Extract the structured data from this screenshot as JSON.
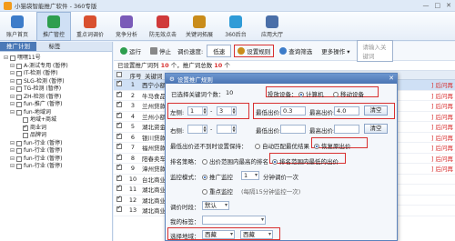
{
  "window": {
    "title": "小猫袋智能推广软件 - 360专版",
    "controls": [
      "—",
      "□",
      "✕"
    ]
  },
  "toolbar": [
    {
      "label": "账户首页",
      "icon": "home-icon",
      "color": "#3d7cc9"
    },
    {
      "label": "推广管控",
      "icon": "chart-icon",
      "color": "#2e9e4e",
      "active": true
    },
    {
      "label": "重点词调价",
      "icon": "target-icon",
      "color": "#d9502f"
    },
    {
      "label": "竞争分析",
      "icon": "eye-icon",
      "color": "#7a5bb8"
    },
    {
      "label": "防无效点击",
      "icon": "shield-icon",
      "color": "#d03a3a"
    },
    {
      "label": "关键词拓展",
      "icon": "key-icon",
      "color": "#c98c1a"
    },
    {
      "label": "360后台",
      "icon": "circle-icon",
      "color": "#2f9bd7"
    },
    {
      "label": "应用大厅",
      "icon": "grid-icon",
      "color": "#4a6fa8"
    }
  ],
  "left_tabs": [
    "推广计划",
    "标签"
  ],
  "tree": [
    {
      "label": "嘿嘿11号",
      "indent": 0,
      "checked": false
    },
    {
      "label": "A-测试专用 (暂停)",
      "indent": 1,
      "checked": false
    },
    {
      "label": "IT-检测 (暂停)",
      "indent": 1,
      "checked": false
    },
    {
      "label": "SLG-检测 (暂停)",
      "indent": 1,
      "checked": false
    },
    {
      "label": "TG-检测 (暂停)",
      "indent": 1,
      "checked": false
    },
    {
      "label": "ZH-检测 (暂停)",
      "indent": 1,
      "checked": false
    },
    {
      "label": "fun-推广 (暂停)",
      "indent": 1,
      "checked": false
    },
    {
      "label": "fun-地域词",
      "indent": 1,
      "checked": false
    },
    {
      "label": "地域+商城",
      "indent": 2,
      "checked": false
    },
    {
      "label": "商业词",
      "indent": 2,
      "checked": true
    },
    {
      "label": "品牌词",
      "indent": 2,
      "checked": false
    },
    {
      "label": "fun-行业 (暂停)",
      "indent": 1,
      "checked": false
    },
    {
      "label": "fun-行业 (暂停)",
      "indent": 1,
      "checked": false
    },
    {
      "label": "fun-行业 (暂停)",
      "indent": 1,
      "checked": false
    },
    {
      "label": "fun-行业 (暂停)",
      "indent": 1,
      "checked": false
    }
  ],
  "actions": {
    "run": "运行",
    "stop": "停止",
    "speed_label": "调价速度:",
    "speed_value": "低速",
    "settings": "设置规则",
    "query": "查询筛选",
    "more": "更多操作 ▾",
    "search_placeholder": "请输入关键词"
  },
  "info": {
    "prefix": "已设置推广词列",
    "count1": "10",
    "mid": "个，推广词总数",
    "count2": "10",
    "suffix": "个"
  },
  "grid": {
    "headers": [
      "序号",
      "关键词"
    ],
    "rows": [
      {
        "n": "1",
        "kw": "西宁小额",
        "tail": "] 后问再"
      },
      {
        "n": "2",
        "kw": "牛马食品",
        "tail": "] 后问再"
      },
      {
        "n": "3",
        "kw": "兰州贷款",
        "tail": "] 后问再"
      },
      {
        "n": "4",
        "kw": "兰州小额",
        "tail": "] 后问再"
      },
      {
        "n": "5",
        "kw": "湖北资金",
        "tail": "] 后问再"
      },
      {
        "n": "6",
        "kw": "银川贷款",
        "tail": "] 后问再"
      },
      {
        "n": "7",
        "kw": "福州贷款",
        "tail": "] 后问再"
      },
      {
        "n": "8",
        "kw": "阳春卖车",
        "tail": "] 后问再"
      },
      {
        "n": "9",
        "kw": "漳州贷款",
        "tail": "] 后问再"
      },
      {
        "n": "10",
        "kw": "台北商业",
        "tail": ""
      },
      {
        "n": "11",
        "kw": "湖北商业",
        "tail": ""
      },
      {
        "n": "12",
        "kw": "湖北商业",
        "tail": ""
      },
      {
        "n": "13",
        "kw": "湖北商业",
        "tail": ""
      }
    ]
  },
  "dialog": {
    "title": "设置推广规则",
    "selected_label": "已选择关键词个数：",
    "selected_count": "10",
    "device_label": "投放设备：",
    "device_pc": "计算机",
    "device_mobile": "移动设备",
    "left_label": "左侧:",
    "left_from": "1",
    "left_to": "3",
    "lowest_label": "最低出价:",
    "lowest_value": "0.3",
    "highest_label": "最高出价:",
    "highest_value": "4.0",
    "clear": "清空",
    "right_label": "右侧:",
    "lowest2_label": "最低出价:",
    "highest2_label": "最高出价:",
    "clear2": "清空",
    "fail_label": "最低出价还不到时设置保持：",
    "fail_opt1": "自动匹配最优结果",
    "fail_opt2": "恢复原出价",
    "rank_label": "排名策略：",
    "rank_opt1": "出价范围内最高的排名",
    "rank_opt2": "排名范围内最低的出价",
    "monitor_label": "监控模式：",
    "monitor_opt1": "推广监控",
    "monitor_select": "1",
    "monitor_hint": "分钟调价一次",
    "monitor_opt2": "重点监控",
    "monitor_hint2": "(每隔15分钟监控一次)",
    "period_label": "调价时段：",
    "period_value": "默认",
    "tag_label": "我的标签：",
    "region_label": "选择地域：",
    "region1": "西藏",
    "region2": "西藏"
  }
}
